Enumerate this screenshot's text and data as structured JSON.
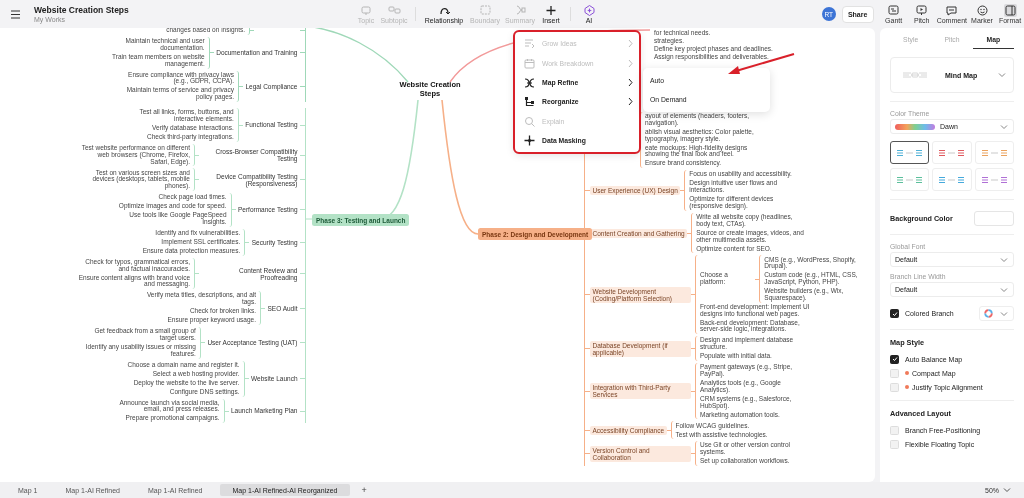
{
  "window": {
    "title": "Website Creation Steps",
    "subtitle": "My Works"
  },
  "toolbar": [
    {
      "label": "Topic",
      "disabled": true
    },
    {
      "label": "Subtopic",
      "disabled": true
    },
    {
      "label": "Relationship",
      "disabled": false
    },
    {
      "label": "Boundary",
      "disabled": true
    },
    {
      "label": "Summary",
      "disabled": true
    },
    {
      "label": "Insert",
      "disabled": false
    },
    {
      "label": "AI",
      "disabled": false
    }
  ],
  "user": {
    "initials": "RT"
  },
  "share_button": "Share",
  "view_buttons": [
    {
      "label": "Gantt",
      "selected": false
    },
    {
      "label": "Pitch",
      "selected": false
    },
    {
      "label": "Comment",
      "selected": false
    },
    {
      "label": "Marker",
      "selected": false
    },
    {
      "label": "Format",
      "selected": true
    }
  ],
  "mind_map": {
    "central_topic": "Website Creation Steps",
    "upper_left_topics": [
      {
        "children": [
          "changes based on insights."
        ]
      },
      {
        "label": "Documentation and Training",
        "children": [
          "Maintain technical and user documentation.",
          "Train team members on website management."
        ]
      },
      {
        "label": "Legal Compliance",
        "children": [
          "Ensure compliance with privacy laws (e.g., GDPR, CCPA).",
          "Maintain terms of service and privacy policy pages."
        ]
      }
    ],
    "upper_right_topics": [
      "for technical needs.",
      "strategies.",
      "Define key project phases and deadlines.",
      "Assign responsibilities and deliverables."
    ],
    "main_topics": [
      {
        "label": "Phase 3: Testing and Launch",
        "color": "#b3e2c6",
        "children": [
          {
            "label": "Functional Testing",
            "children": [
              "Test all links, forms, buttons, and interactive elements.",
              "Verify database interactions.",
              "Check third-party integrations."
            ]
          },
          {
            "label": "Cross-Browser Compatibility Testing",
            "children": [
              "Test website performance on different web browsers (Chrome, Firefox, Safari, Edge)."
            ]
          },
          {
            "label": "Device Compatibility Testing (Responsiveness)",
            "children": [
              "Test on various screen sizes and devices (desktops, tablets, mobile phones)."
            ]
          },
          {
            "label": "Performance Testing",
            "children": [
              "Check page load times.",
              "Optimize images and code for speed.",
              "Use tools like Google PageSpeed Insights."
            ]
          },
          {
            "label": "Security Testing",
            "children": [
              "Identify and fix vulnerabilities.",
              "Implement SSL certificates.",
              "Ensure data protection measures."
            ]
          },
          {
            "label": "Content Review and Proofreading",
            "children": [
              "Check for typos, grammatical errors, and factual inaccuracies.",
              "Ensure content aligns with brand voice and messaging."
            ]
          },
          {
            "label": "SEO Audit",
            "children": [
              "Verify meta titles, descriptions, and alt tags.",
              "Check for broken links.",
              "Ensure proper keyword usage."
            ]
          },
          {
            "label": "User Acceptance Testing (UAT)",
            "children": [
              "Get feedback from a small group of target users.",
              "Identify any usability issues or missing features."
            ]
          },
          {
            "label": "Website Launch",
            "children": [
              "Choose a domain name and register it.",
              "Select a web hosting provider.",
              "Deploy the website to the live server.",
              "Configure DNS settings."
            ]
          },
          {
            "label": "Launch Marketing Plan",
            "children": [
              "Announce launch via social media, email, and press releases.",
              "Prepare promotional campaigns."
            ]
          }
        ]
      },
      {
        "label": "Phase 2: Design and Development",
        "color": "#f6b088",
        "children": [
          {
            "children": [
              "ayout of elements (headers, footers, navigation).",
              "ablish visual aesthetics: Color palette, typography, imagery style.",
              "eate mockups: High-fidelity designs showing the final look and feel.",
              "Ensure brand consistency."
            ]
          },
          {
            "label": "User Experience (UX) Design",
            "children": [
              "Focus on usability and accessibility.",
              "Design intuitive user flows and interactions.",
              "Optimize for different devices (responsive design)."
            ]
          },
          {
            "label": "Content Creation and Gathering",
            "children": [
              "Write all website copy (headlines, body text, CTAs).",
              "Source or create images, videos, and other multimedia assets.",
              "Optimize content for SEO."
            ]
          },
          {
            "label": "Website Development (Coding/Platform Selection)",
            "children": [
              {
                "label": "Choose a platform:",
                "children": [
                  "CMS (e.g., WordPress, Shopify, Drupal).",
                  "Custom code (e.g., HTML, CSS, JavaScript, Python, PHP).",
                  "Website builders (e.g., Wix, Squarespace)."
                ]
              },
              "Front-end development: Implement UI designs into functional web pages.",
              "Back-end development: Database, server-side logic, integrations."
            ]
          },
          {
            "label": "Database Development (if applicable)",
            "children": [
              "Design and implement database structure.",
              "Populate with initial data."
            ]
          },
          {
            "label": "Integration with Third-Party Services",
            "children": [
              "Payment gateways (e.g., Stripe, PayPal).",
              "Analytics tools (e.g., Google Analytics).",
              "CRM systems (e.g., Salesforce, HubSpot).",
              "Marketing automation tools."
            ]
          },
          {
            "label": "Accessibility Compliance",
            "children": [
              "Follow WCAG guidelines.",
              "Test with assistive technologies."
            ]
          },
          {
            "label": "Version Control and Collaboration",
            "children": [
              "Use Git or other version control systems.",
              "Set up collaboration workflows."
            ]
          }
        ]
      }
    ]
  },
  "ai_menu": {
    "items": [
      {
        "label": "Grow Ideas",
        "disabled": true,
        "has_submenu": true
      },
      {
        "label": "Work Breakdown",
        "disabled": true,
        "has_submenu": true
      },
      {
        "label": "Map Refine",
        "disabled": false,
        "has_submenu": true,
        "submenu": [
          "Auto",
          "On Demand"
        ]
      },
      {
        "label": "Reorganize",
        "disabled": false,
        "has_submenu": true
      },
      {
        "label": "Explain",
        "disabled": true,
        "has_submenu": false
      },
      {
        "label": "Data Masking",
        "disabled": false,
        "has_submenu": false
      }
    ]
  },
  "format_panel": {
    "tabs": [
      {
        "label": "Style",
        "selected": false
      },
      {
        "label": "Pitch",
        "selected": false
      },
      {
        "label": "Map",
        "selected": true
      }
    ],
    "structure": "Mind Map",
    "color_theme": {
      "label": "Color Theme",
      "value": "Dawn",
      "themes": [
        {
          "color": "#4fb0d6",
          "selected": true
        },
        {
          "color": "#e0595e",
          "selected": false
        },
        {
          "color": "#eba35f",
          "selected": false
        },
        {
          "color": "#5cbf9c",
          "selected": false
        },
        {
          "color": "#45a9dc",
          "selected": false
        },
        {
          "color": "#b070d6",
          "selected": false
        }
      ]
    },
    "background_color": {
      "label": "Background Color"
    },
    "global_font": {
      "label": "Global Font",
      "value": "Default"
    },
    "branch_line_width": {
      "label": "Branch Line Width",
      "value": "Default"
    },
    "colored_branch": {
      "label": "Colored Branch",
      "checked": true
    },
    "map_style": {
      "title": "Map Style",
      "options": [
        {
          "label": "Auto Balance Map",
          "checked": true,
          "premium": false
        },
        {
          "label": "Compact Map",
          "checked": false,
          "premium": true
        },
        {
          "label": "Justify Topic Alignment",
          "checked": false,
          "premium": true
        }
      ]
    },
    "advanced_layout": {
      "title": "Advanced Layout",
      "options": [
        {
          "label": "Branch Free-Positioning",
          "checked": false
        },
        {
          "label": "Flexible Floating Topic",
          "checked": false
        }
      ]
    }
  },
  "sheets": [
    {
      "label": "Map 1",
      "selected": false
    },
    {
      "label": "Map 1-AI Refined",
      "selected": false
    },
    {
      "label": "Map 1-AI Refined",
      "selected": false
    },
    {
      "label": "Map 1-AI Refined-AI Reorganized",
      "selected": true
    }
  ],
  "add_sheet": "+",
  "zoom": "50%"
}
